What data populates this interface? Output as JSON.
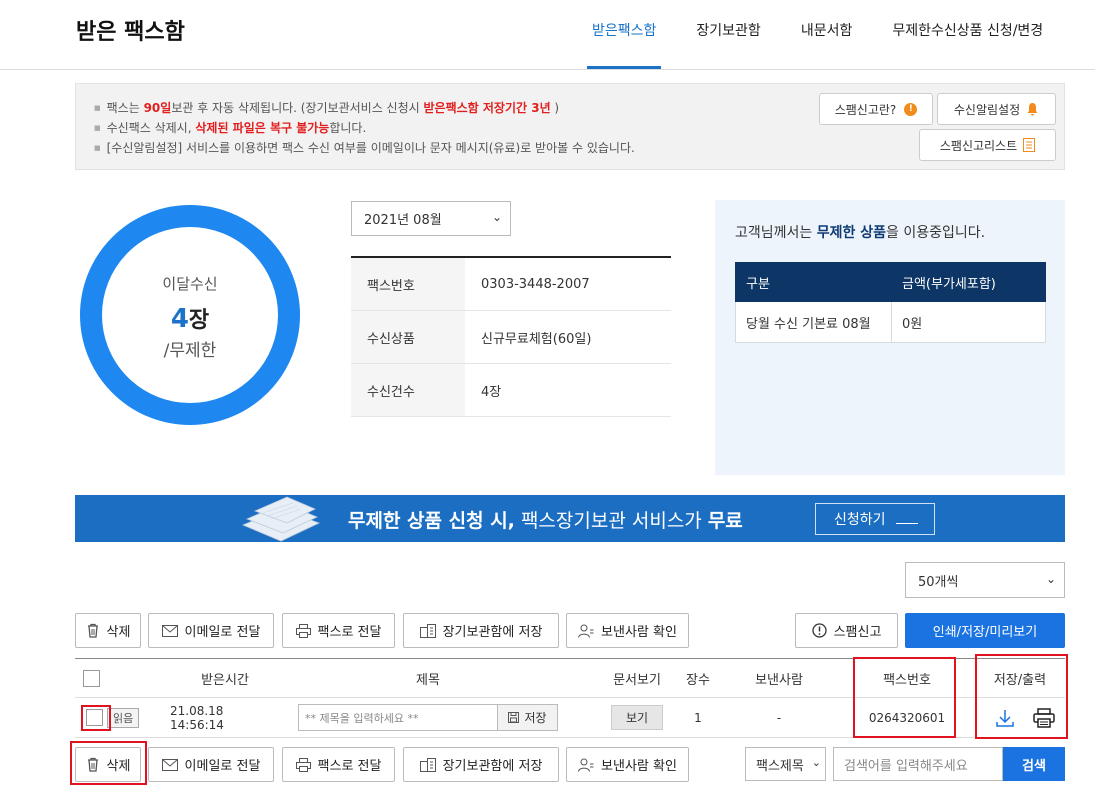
{
  "header": {
    "title": "받은 팩스함",
    "nav": [
      "받은팩스함",
      "장기보관함",
      "내문서함",
      "무제한수신상품 신청/변경"
    ]
  },
  "notice": {
    "line1": {
      "a": "팩스는 ",
      "b": "90일",
      "c": "보관 후 자동 삭제됩니다. (장기보관서비스 신청시 ",
      "d": "받은팩스함 저장기간 3년",
      "e": " )"
    },
    "line2": {
      "a": "수신팩스 삭제시, ",
      "b": "삭제된 파일은 복구 불가능",
      "c": "합니다."
    },
    "line3": "[수신알림설정] 서비스를 이용하면 팩스 수신 여부를 이메일이나 문자 메시지(유료)로 받아볼 수 있습니다.",
    "spam_info_btn": "스팸신고란?",
    "alert_setting_btn": "수신알림설정",
    "spam_list_btn": "스팸신고리스트"
  },
  "summary": {
    "label": "이달수신",
    "count": "4",
    "unit": "장",
    "limit": "/무제한",
    "month": "2021년 08월",
    "rows": [
      {
        "k": "팩스번호",
        "v": "0303-3448-2007"
      },
      {
        "k": "수신상품",
        "v": "신규무료체험(60일)"
      },
      {
        "k": "수신건수",
        "v": "4장"
      }
    ]
  },
  "plan_box": {
    "msg_a": "고객님께서는 ",
    "msg_b": "무제한 상품",
    "msg_c": "을 이용중입니다.",
    "col1": "구분",
    "col2": "금액(부가세포함)",
    "row_item": "당월 수신 기본료 08월",
    "row_amount": "0원"
  },
  "banner": {
    "text_a": "무제한 상품 신청 시,",
    "text_b": " 팩스장기보관 서비스가 ",
    "text_c": "무료",
    "btn": "신청하기"
  },
  "list": {
    "per_page": "50개씩",
    "actions": {
      "delete": "삭제",
      "email": "이메일로 전달",
      "fax": "팩스로 전달",
      "archive": "장기보관함에 저장",
      "sender": "보낸사람 확인",
      "spam": "스팸신고",
      "print": "인쇄/저장/미리보기"
    },
    "columns": [
      "받은시간",
      "제목",
      "문서보기",
      "장수",
      "보낸사람",
      "팩스번호",
      "저장/출력"
    ],
    "rows": [
      {
        "read": "읽음",
        "time": "21.08.18 14:56:14",
        "title_placeholder": "** 제목을 입력하세요 **",
        "save": "저장",
        "view": "보기",
        "pages": "1",
        "sender": "-",
        "fax_no": "0264320601"
      }
    ],
    "search": {
      "field": "팩스제목",
      "placeholder": "검색어를 입력해주세요",
      "button": "검색"
    }
  },
  "colors": {
    "accent": "#1a73e0",
    "navy": "#0d3566",
    "highlight": "#e0141e"
  }
}
